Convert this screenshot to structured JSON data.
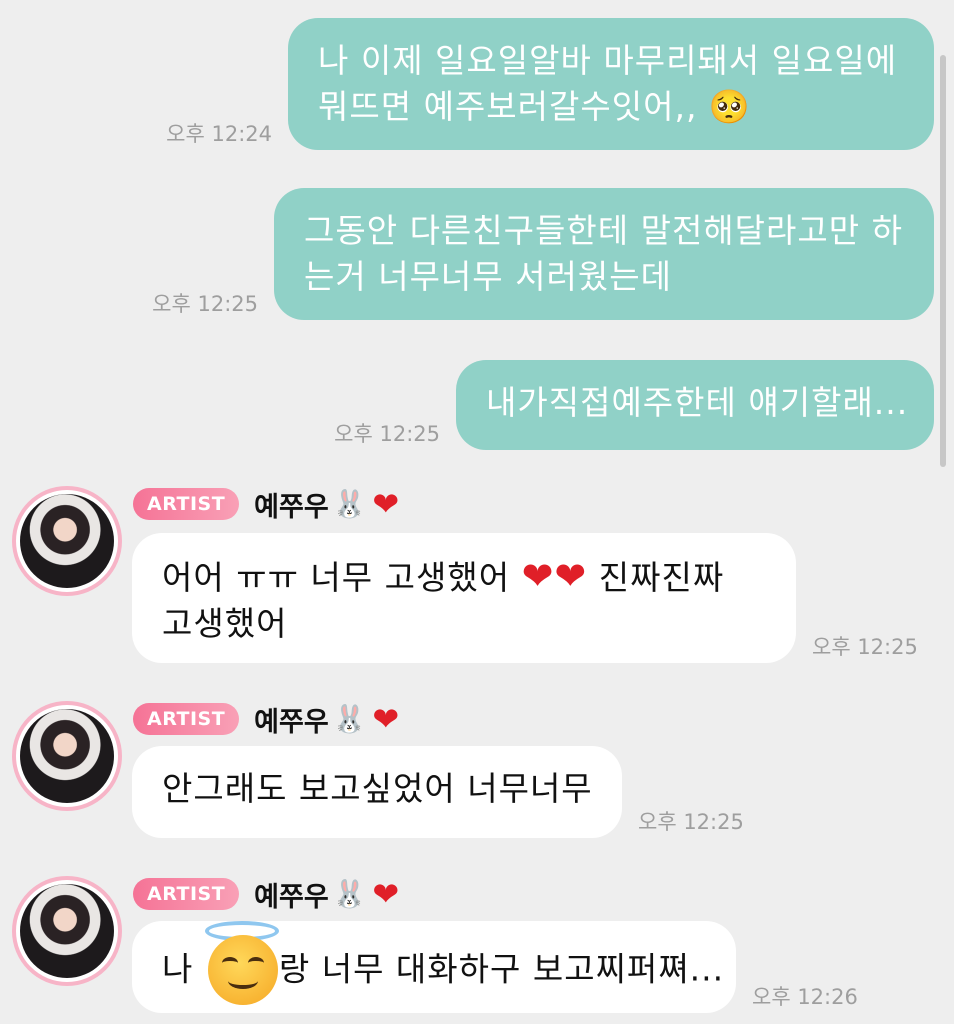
{
  "messages_sent": [
    {
      "lines": [
        "나 이제 일요일알바 마무리돼서 일요일에",
        "뭐뜨면 예주보러갈수잇어,, 🥺"
      ],
      "time": "오후 12:24"
    },
    {
      "lines": [
        "그동안 다른친구들한테 말전해달라고만 하",
        "는거 너무너무 서러웠는데"
      ],
      "time": "오후 12:25"
    },
    {
      "lines": [
        "내가직접예주한테 얘기할래..."
      ],
      "time": "오후 12:25"
    }
  ],
  "sender": {
    "badge": "ARTIST",
    "name": "예쭈우",
    "name_emoji": "🐰",
    "name_heart": "❤"
  },
  "messages_received": [
    {
      "line1_a": "어어 ㅠㅠ 너무 고생했어 ",
      "hearts": "❤❤",
      "line1_b": " 진짜진짜",
      "line2": "고생했어",
      "time": "오후 12:25"
    },
    {
      "text": "안그래도 보고싶었어 너무너무",
      "time": "오후 12:25"
    },
    {
      "text_a": "나 ",
      "text_b": "랑 너무 대화하구 보고찌퍼쪄...",
      "time": "오후 12:26"
    }
  ],
  "colors": {
    "sent_bubble": "#90d1c7",
    "received_bubble": "#ffffff",
    "background": "#eeeeee",
    "badge": "#f57396"
  },
  "icons": {
    "avatar": "profile-photo",
    "inline_emoji": "smiling-face-with-halo-emoji"
  }
}
